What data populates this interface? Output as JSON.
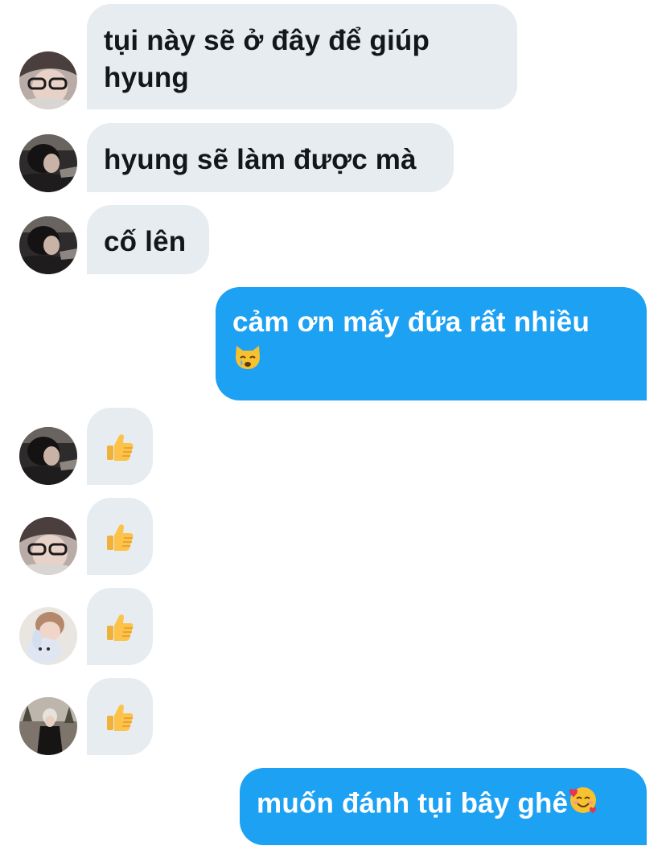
{
  "conversation": {
    "messages": [
      {
        "from": "friend",
        "text": "tụi này sẽ ở đây để giúp\nhyung"
      },
      {
        "from": "friend",
        "text": "hyung sẽ làm được mà"
      },
      {
        "from": "friend",
        "text": "cố lên"
      },
      {
        "from": "me",
        "text": "cảm ơn mấy đứa rất nhiều",
        "emoji": "crying-cat-face"
      },
      {
        "from": "friend",
        "emoji": "thumbs-up"
      },
      {
        "from": "friend",
        "emoji": "thumbs-up"
      },
      {
        "from": "friend",
        "emoji": "thumbs-up"
      },
      {
        "from": "friend",
        "emoji": "thumbs-up"
      },
      {
        "from": "me",
        "text": "muốn đánh tụi bây ghê",
        "emoji": "smiling-face-with-hearts"
      }
    ]
  },
  "colors": {
    "incoming_bubble": "#e6ecf0",
    "outgoing_bubble": "#1da1f2",
    "incoming_text": "#14171a",
    "outgoing_text": "#ffffff"
  }
}
